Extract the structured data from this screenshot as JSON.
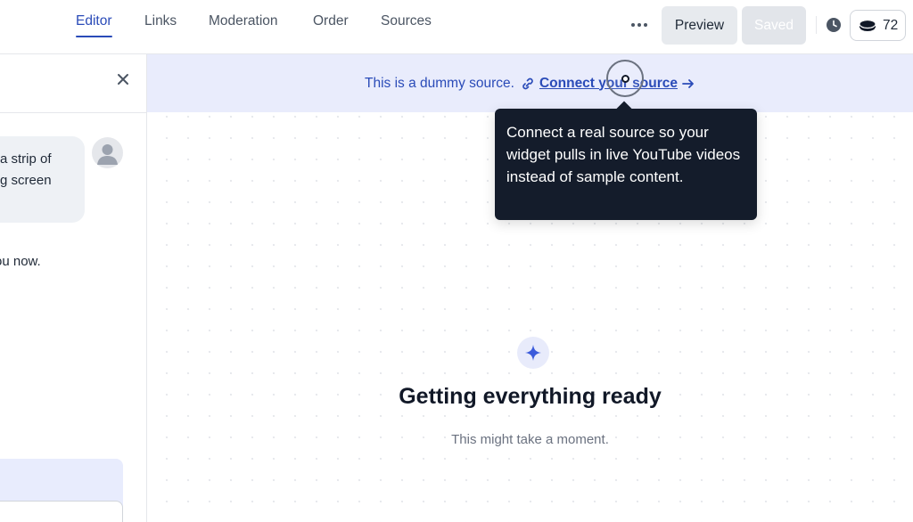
{
  "nav": {
    "tabs": [
      {
        "label": "Editor",
        "active": true
      },
      {
        "label": "Links"
      },
      {
        "label": "Moderation"
      },
      {
        "label": "Order"
      },
      {
        "label": "Sources"
      }
    ]
  },
  "toolbar": {
    "preview_label": "Preview",
    "saved_label": "Saved",
    "credits_count": "72"
  },
  "chat": {
    "bubble_line1": "a strip of",
    "bubble_line2": "g screen",
    "message_text": "ou now."
  },
  "banner": {
    "text": "This is a dummy source.",
    "link_text": "Connect your source"
  },
  "tooltip": {
    "text": "Connect a real source so your widget pulls in live YouTube videos instead of sample content."
  },
  "loading": {
    "title": "Getting everything ready",
    "subtitle": "This might take a moment."
  },
  "colors": {
    "accent": "#2a4bb8",
    "banner_bg": "#e9ecfc",
    "tooltip_bg": "#141c2b"
  }
}
